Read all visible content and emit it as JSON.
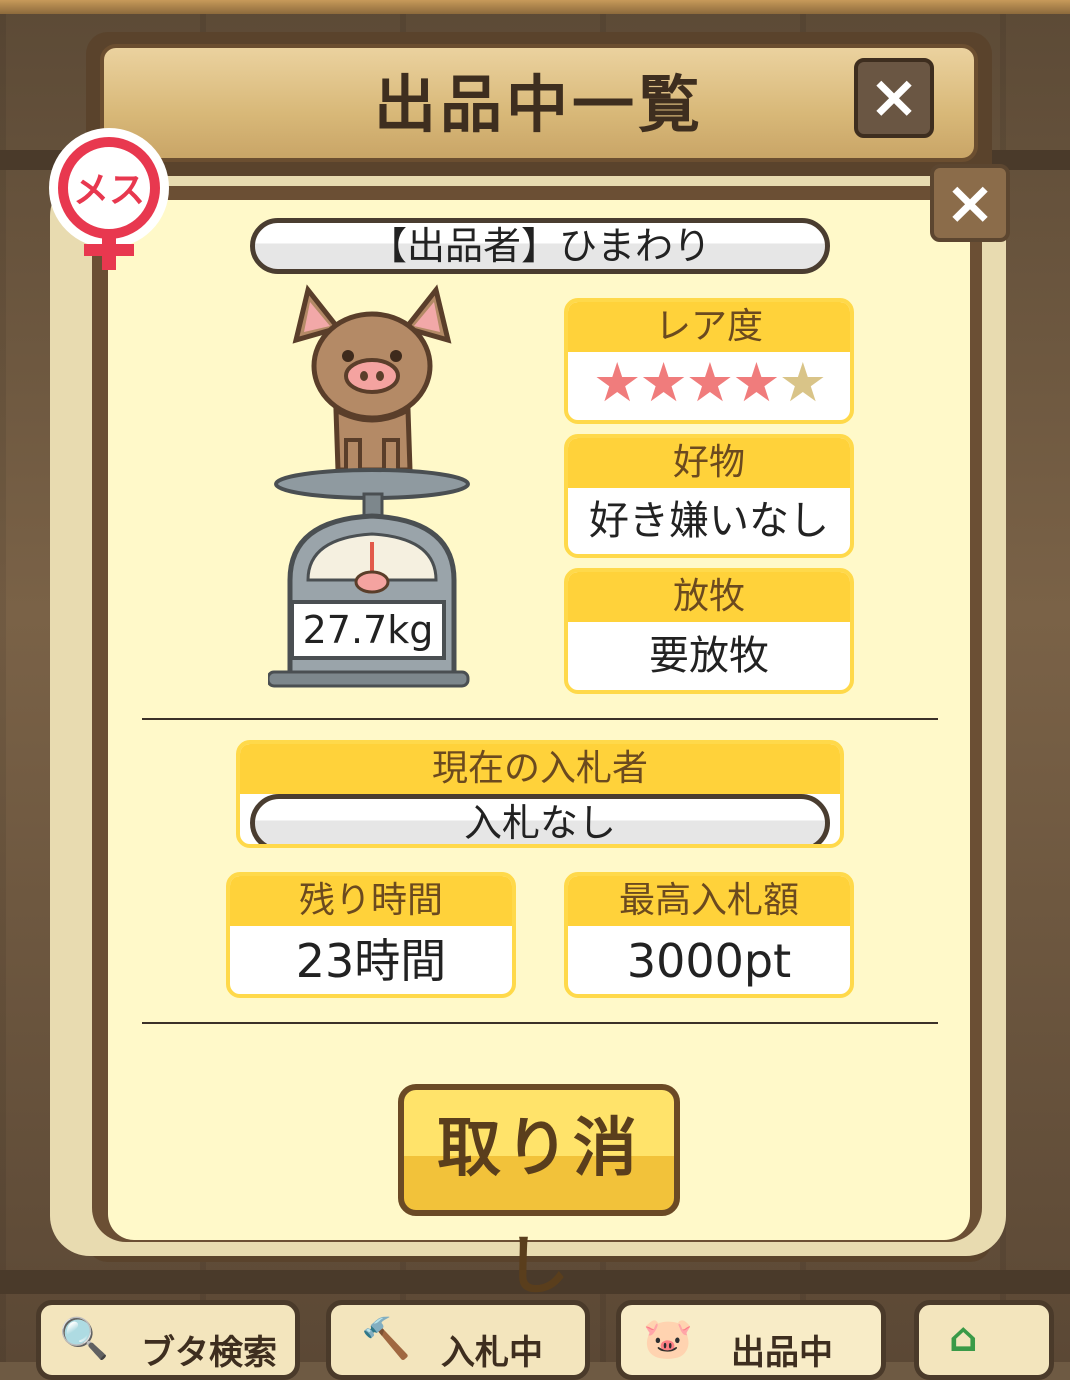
{
  "title": "出品中一覧",
  "seller_label": "【出品者】ひまわり",
  "gender": "メス",
  "weight": "27.7kg",
  "rarity": {
    "label": "レア度",
    "stars": 4,
    "max_stars": 5,
    "star_glyph": "★"
  },
  "favorite": {
    "label": "好物",
    "value": "好き嫌いなし"
  },
  "grazing": {
    "label": "放牧",
    "value": "要放牧"
  },
  "current_bidder": {
    "label": "現在の入札者",
    "value": "入札なし"
  },
  "remaining_time": {
    "label": "残り時間",
    "value": "23時間"
  },
  "max_bid": {
    "label": "最高入札額",
    "value": "3000pt"
  },
  "cancel_label": "取り消し",
  "close_glyph": "×",
  "tabs": [
    {
      "label": "ブタ検索",
      "icon": "magnifier-icon"
    },
    {
      "label": "入札中",
      "icon": "gavel-icon"
    },
    {
      "label": "出品中",
      "icon": "pig-icon"
    },
    {
      "label": "",
      "icon": "home-icon"
    }
  ],
  "colors": {
    "panel_bg": "#fff9c9",
    "header_yellow": "#ffd23a",
    "star_on": "#f07c7c",
    "star_off": "#d9c488"
  }
}
